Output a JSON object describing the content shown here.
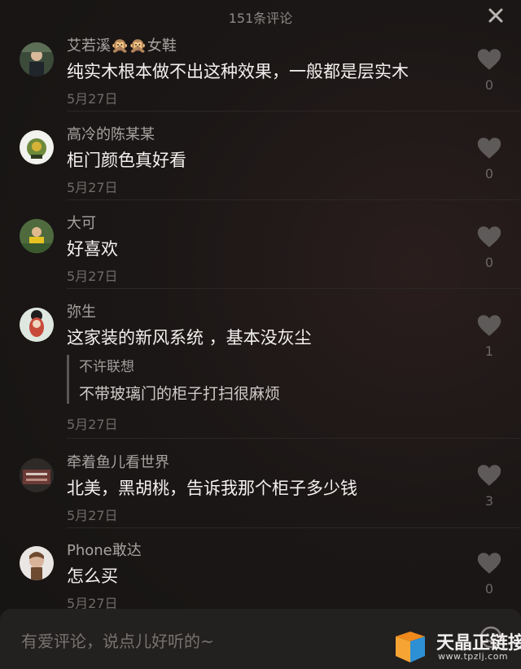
{
  "header": {
    "title": "151条评论",
    "close_icon": "close-icon"
  },
  "comments": [
    {
      "username": "艾若溪🙊🙊女鞋",
      "text": "纯实木根本做不出这种效果，一般都是层实木",
      "date": "5月27日",
      "likes": "0"
    },
    {
      "username": "高冷的陈某某",
      "text": "柜门颜色真好看",
      "date": "5月27日",
      "likes": "0"
    },
    {
      "username": "大可",
      "text": "好喜欢",
      "date": "5月27日",
      "likes": "0"
    },
    {
      "username": "弥生",
      "text": "这家装的新风系统 ，基本没灰尘",
      "date": "5月27日",
      "likes": "1",
      "reply": {
        "username": "不许联想",
        "text": "不带玻璃门的柜子打扫很麻烦"
      }
    },
    {
      "username": "牵着鱼儿看世界",
      "text": "北美，黑胡桃，告诉我那个柜子多少钱",
      "date": "5月27日",
      "likes": "3"
    },
    {
      "username": "Phone敢达",
      "text": "怎么买",
      "date": "5月27日",
      "likes": "0"
    }
  ],
  "input": {
    "placeholder": "有爱评论，说点儿好听的~"
  },
  "watermark": {
    "title": "天晶正链接",
    "url": "www.tpzlj.com"
  },
  "colors": {
    "background": "#1b1716",
    "text": "#f3f1ef",
    "muted": "#6f6b69",
    "username": "#a7a3a1"
  }
}
